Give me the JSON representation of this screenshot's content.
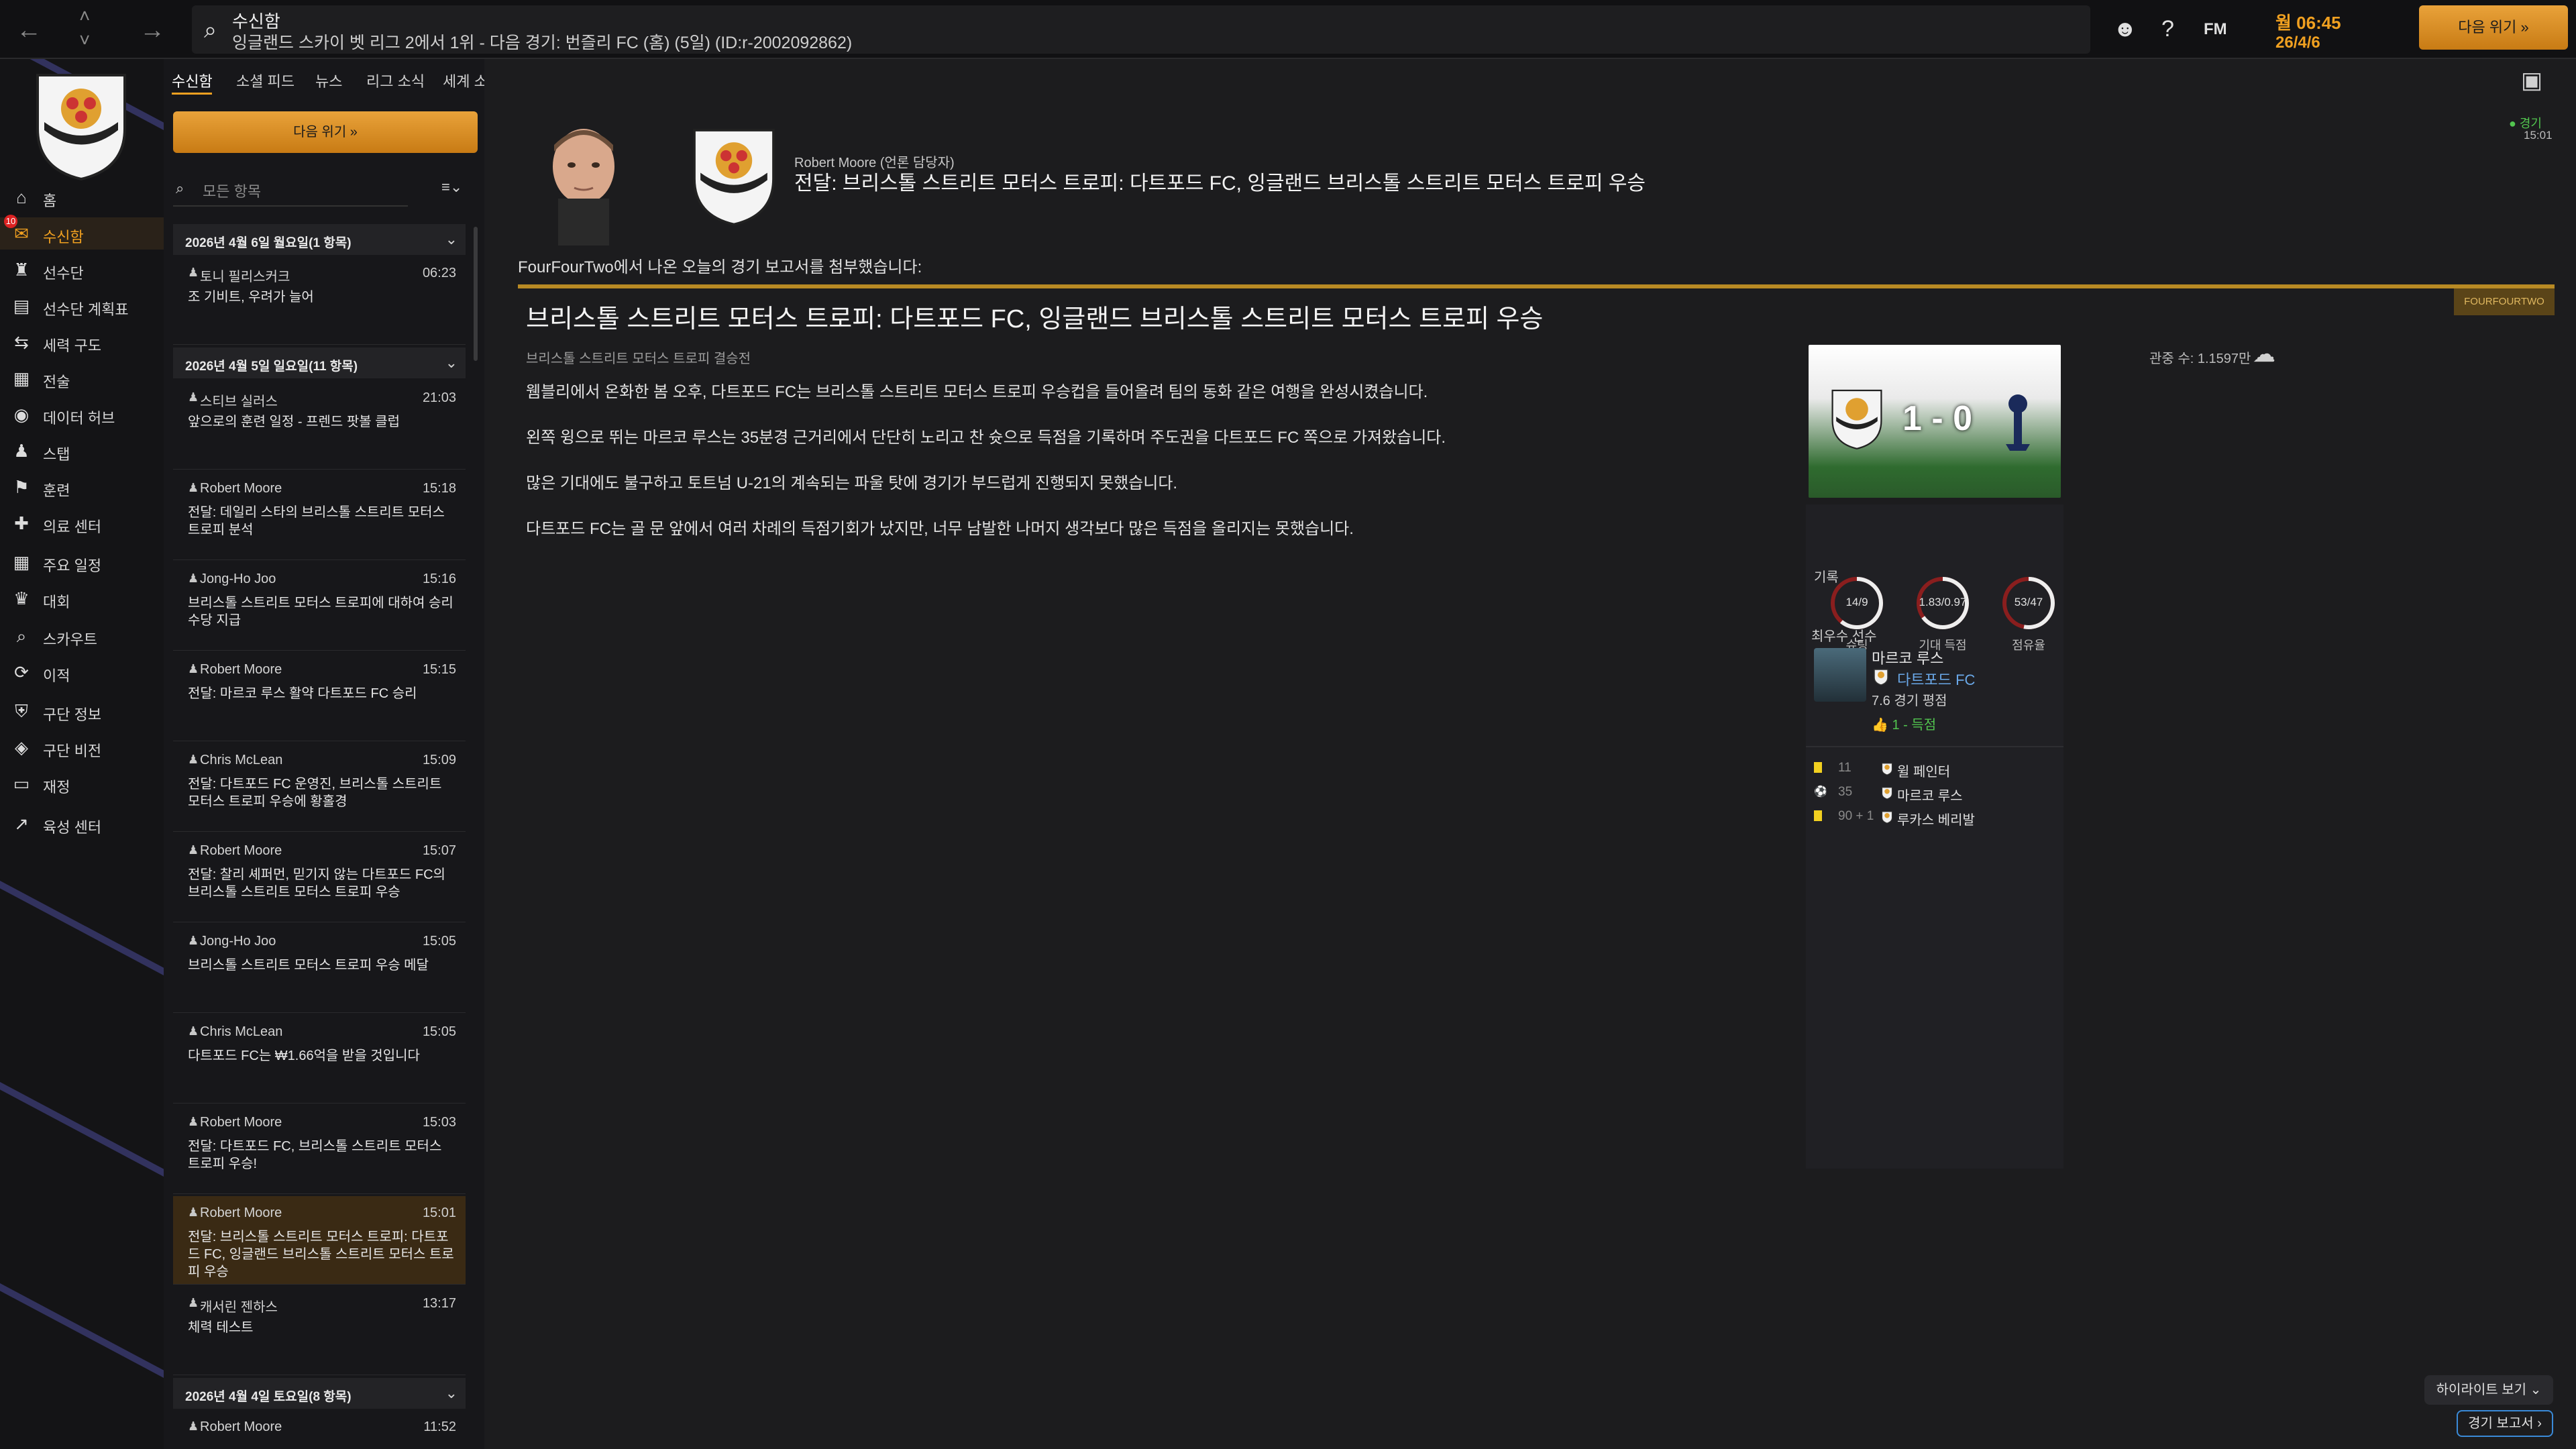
{
  "topbar": {
    "title": "수신함",
    "subtitle": "잉글랜드 스카이 벳 리그 2에서 1위 - 다음 경기: 번즐리 FC (홈) (5일) (ID:r-2002092862)",
    "fm_label": "FM",
    "time": "월 06:45",
    "date": "26/4/6",
    "continue_label": "다음 위기 »"
  },
  "sidebar": {
    "items": [
      {
        "label": "홈",
        "icon": "home-icon"
      },
      {
        "label": "수신함",
        "icon": "inbox-icon",
        "badge": "10",
        "active": true
      },
      {
        "label": "선수단",
        "icon": "squad-icon"
      },
      {
        "label": "선수단 계획표",
        "icon": "clipboard-icon"
      },
      {
        "label": "세력 구도",
        "icon": "dynamics-icon"
      },
      {
        "label": "전술",
        "icon": "tactics-icon"
      },
      {
        "label": "데이터 허브",
        "icon": "data-hub-icon"
      },
      {
        "label": "스탭",
        "icon": "staff-icon"
      },
      {
        "label": "훈련",
        "icon": "training-icon"
      },
      {
        "label": "의료 센터",
        "icon": "medical-icon"
      },
      {
        "label": "주요 일정",
        "icon": "calendar-icon"
      },
      {
        "label": "대회",
        "icon": "trophy-icon"
      },
      {
        "label": "스카우트",
        "icon": "scout-icon"
      },
      {
        "label": "이적",
        "icon": "transfer-icon"
      },
      {
        "label": "구단 정보",
        "icon": "club-info-icon"
      },
      {
        "label": "구단 비전",
        "icon": "vision-icon"
      },
      {
        "label": "재정",
        "icon": "finance-icon"
      },
      {
        "label": "육성 센터",
        "icon": "development-icon"
      }
    ]
  },
  "list": {
    "tabs": [
      "수신함",
      "소셜 피드",
      "뉴스",
      "리그 소식",
      "세계 소식"
    ],
    "continue_label": "다음 위기 »",
    "filter_placeholder": "모든 항목",
    "groups": [
      {
        "title": "2026년 4월 6일 월요일(1 항목)"
      },
      {
        "title": "2026년 4월 5일 일요일(11 항목)"
      },
      {
        "title": "2026년 4월 4일 토요일(8 항목)"
      }
    ],
    "messages": [
      {
        "sender": "토니 필리스커크",
        "time": "06:23",
        "subject": "조 기비트, 우려가 늘어"
      },
      {
        "sender": "스티브 실러스",
        "time": "21:03",
        "subject": "앞으로의 훈련 일정 - 프렌드 팟볼 클럽"
      },
      {
        "sender": "Robert Moore",
        "time": "15:18",
        "subject": "전달: 데일리 스타의 브리스톨 스트리트 모터스 트로피 분석"
      },
      {
        "sender": "Jong-Ho Joo",
        "time": "15:16",
        "subject": "브리스톨 스트리트 모터스 트로피에 대하여 승리 수당 지급"
      },
      {
        "sender": "Robert Moore",
        "time": "15:15",
        "subject": "전달: 마르코 루스 활약 다트포드 FC 승리"
      },
      {
        "sender": "Chris McLean",
        "time": "15:09",
        "subject": "전달: 다트포드 FC 운영진, 브리스톨 스트리트 모터스 트로피 우승에 황홀경"
      },
      {
        "sender": "Robert Moore",
        "time": "15:07",
        "subject": "전달: 찰리 셰퍼먼, 믿기지 않는 다트포드 FC의 브리스톨 스트리트 모터스 트로피 우승"
      },
      {
        "sender": "Jong-Ho Joo",
        "time": "15:05",
        "subject": "브리스톨 스트리트 모터스 트로피 우승 메달"
      },
      {
        "sender": "Chris McLean",
        "time": "15:05",
        "subject": "다트포드 FC는 ₩1.66억을 받을 것입니다"
      },
      {
        "sender": "Robert Moore",
        "time": "15:03",
        "subject": "전달: 다트포드 FC, 브리스톨 스트리트 모터스 트로피 우승!"
      },
      {
        "sender": "Robert Moore",
        "time": "15:01",
        "subject": "전달: 브리스톨 스트리트 모터스 트로피: 다트포드 FC, 잉글랜드 브리스톨 스트리트 모터스 트로피 우승",
        "active": true
      },
      {
        "sender": "캐서린 젠하스",
        "time": "13:17",
        "subject": "체력 테스트"
      },
      {
        "sender": "Robert Moore",
        "time": "11:52",
        "subject": ""
      }
    ]
  },
  "message": {
    "from": "Robert Moore (언론 담당자)",
    "title": "전달: 브리스톨 스트리트 모터스 트로피: 다트포드 FC, 잉글랜드 브리스톨 스트리트 모터스 트로피 우승",
    "live_label": "경기",
    "live_time": "15:01",
    "intro": "FourFourTwo에서 나온 오늘의 경기 보고서를 첨부했습니다:",
    "source": "FOURFOURTWO",
    "article_title": "브리스톨 스트리트 모터스 트로피: 다트포드 FC, 잉글랜드 브리스톨 스트리트 모터스 트로피 우승",
    "article_sub": "브리스톨 스트리트 모터스 트로피 결승전",
    "attendance": "관중 수: 1.1597만",
    "paragraphs": [
      "웸블리에서 온화한 봄 오후, 다트포드 FC는 브리스톨 스트리트 모터스 트로피 우승컵을 들어올려 팀의 동화 같은 여행을 완성시켰습니다.",
      "왼쪽 윙으로 뛰는 마르코 루스는 35분경 근거리에서 단단히 노리고 찬 슛으로 득점을 기록하며 주도권을 다트포드 FC 쪽으로 가져왔습니다.",
      "많은 기대에도 불구하고 토트넘 U-21의 계속되는 파울 탓에 경기가 부드럽게 진행되지 못했습니다.",
      "다트포드 FC는 골 문 앞에서 여러 차례의 득점기회가 났지만, 너무 남발한 나머지 생각보다 많은 득점을 올리지는 못했습니다."
    ]
  },
  "match": {
    "score": "1 - 0",
    "record_label": "기록",
    "stats": [
      {
        "value": "14/9",
        "label": "슈팅",
        "home_share": 0.61
      },
      {
        "value": "1.83/0.97",
        "label": "기대 득점",
        "home_share": 0.65
      },
      {
        "value": "53/47",
        "label": "점유율",
        "home_share": 0.53
      }
    ],
    "pom_label": "최우수 선수",
    "pom_name": "마르코 루스",
    "pom_club": "다트포드 FC",
    "pom_rating": "7.6 경기 평점",
    "pom_goals": "1 - 득점",
    "events": [
      {
        "minute": "11",
        "name": "윌 페인터",
        "type": "yellow-card"
      },
      {
        "minute": "35",
        "name": "마르코 루스",
        "type": "goal"
      },
      {
        "minute": "90 + 1",
        "name": "루카스 베리발",
        "type": "yellow-card"
      }
    ],
    "highlights_label": "하이라이트 보기",
    "report_label": "경기 보고서 ›"
  },
  "colors": {
    "accent": "#f0a020",
    "live": "#52c44f",
    "link": "#6aa8e8"
  }
}
